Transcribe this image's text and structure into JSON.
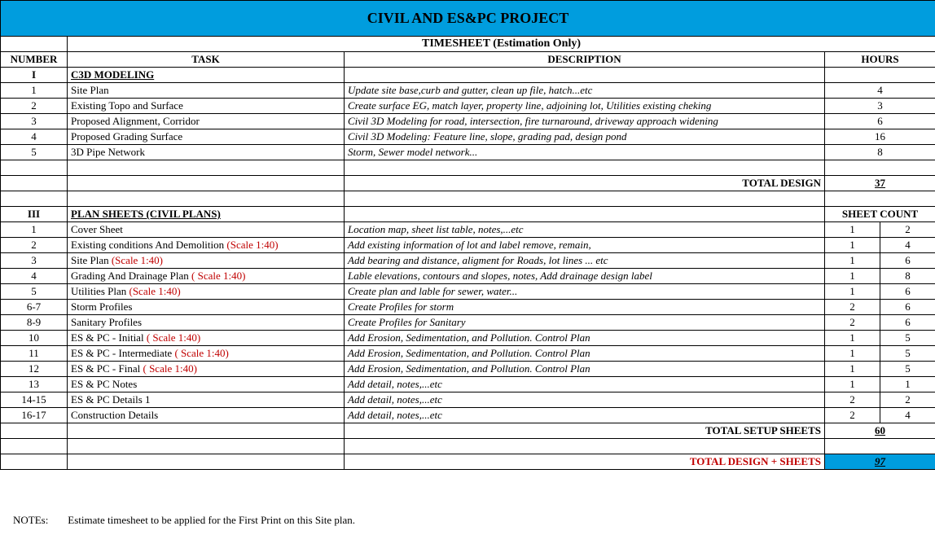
{
  "banner": "CIVIL AND ES&PC PROJECT",
  "subtitle": "TIMESHEET (Estimation Only)",
  "headers": {
    "number": "NUMBER",
    "task": "TASK",
    "description": "DESCRIPTION",
    "hours": "HOURS",
    "sheet_count": "SHEET COUNT"
  },
  "section1": {
    "num": "I",
    "title": "C3D MODELING",
    "rows": [
      {
        "n": "1",
        "task": "Site Plan",
        "desc": "Update site base,curb and gutter, clean up file, hatch...etc",
        "h": "4"
      },
      {
        "n": "2",
        "task": "Existing Topo and Surface",
        "desc": "Create surface EG, match layer, property line, adjoining lot, Utilities existing cheking",
        "h": "3"
      },
      {
        "n": "3",
        "task": "Proposed Alignment, Corridor",
        "desc": "Civil 3D Modeling for road, intersection, fire turnaround, driveway approach widening",
        "h": "6"
      },
      {
        "n": "4",
        "task": "Proposed Grading Surface",
        "desc": "Civil 3D Modeling:  Feature line, slope, grading pad, design pond",
        "h": "16"
      },
      {
        "n": "5",
        "task": "3D Pipe Network",
        "desc": "Storm, Sewer model network...",
        "h": "8"
      }
    ],
    "total_label": "TOTAL DESIGN",
    "total": "37"
  },
  "section3": {
    "num": "III",
    "title": "PLAN SHEETS (CIVIL PLANS)",
    "rows": [
      {
        "n": "1",
        "task": "Cover Sheet",
        "scale": "",
        "desc": "Location map, sheet list table, notes,...etc",
        "c1": "1",
        "c2": "2"
      },
      {
        "n": "2",
        "task": "Existing conditions And Demolition ",
        "scale": "(Scale 1:40)",
        "desc": "Add existing information of lot and  label remove, remain,",
        "c1": "1",
        "c2": "4"
      },
      {
        "n": "3",
        "task": "Site Plan ",
        "scale": "(Scale 1:40)",
        "desc": "Add bearing and distance, aligment for Roads, lot lines ... etc",
        "c1": "1",
        "c2": "6"
      },
      {
        "n": "4",
        "task": "Grading And Drainage Plan ",
        "scale": "( Scale 1:40)",
        "desc": "Lable elevations, contours and slopes, notes, Add drainage design label",
        "c1": "1",
        "c2": "8"
      },
      {
        "n": "5",
        "task": "Utilities Plan ",
        "scale": "(Scale 1:40)",
        "desc": "Create plan and lable for sewer, water...",
        "c1": "1",
        "c2": "6"
      },
      {
        "n": "6-7",
        "task": "Storm Profiles",
        "scale": "",
        "desc": "Create Profiles for storm",
        "c1": "2",
        "c2": "6"
      },
      {
        "n": "8-9",
        "task": "Sanitary Profiles",
        "scale": "",
        "desc": "Create Profiles for Sanitary",
        "c1": "2",
        "c2": "6"
      },
      {
        "n": "10",
        "task": "ES & PC - Initial ",
        "scale": "( Scale 1:40)",
        "desc": "Add Erosion, Sedimentation, and Pollution. Control Plan",
        "c1": "1",
        "c2": "5"
      },
      {
        "n": "11",
        "task": "ES & PC - Intermediate  ",
        "scale": "( Scale 1:40)",
        "desc": "Add Erosion, Sedimentation, and Pollution. Control Plan",
        "c1": "1",
        "c2": "5"
      },
      {
        "n": "12",
        "task": "ES & PC - Final  ",
        "scale": "( Scale 1:40)",
        "desc": "Add Erosion, Sedimentation, and Pollution. Control Plan",
        "c1": "1",
        "c2": "5"
      },
      {
        "n": "13",
        "task": "ES & PC Notes",
        "scale": "",
        "desc": "Add detail, notes,...etc",
        "c1": "1",
        "c2": "1"
      },
      {
        "n": "14-15",
        "task": "ES & PC Details 1",
        "scale": "",
        "desc": "Add detail, notes,...etc",
        "c1": "2",
        "c2": "2"
      },
      {
        "n": "16-17",
        "task": "Construction Details",
        "scale": "",
        "desc": "Add detail, notes,...etc",
        "c1": "2",
        "c2": "4"
      }
    ],
    "total_label": "TOTAL SETUP SHEETS",
    "total": "60"
  },
  "grand": {
    "label": "TOTAL DESIGN + SHEETS",
    "value": "97"
  },
  "notes": {
    "label": "NOTEs:",
    "text": "Estimate timesheet to be applied for the First Print on this Site plan."
  }
}
